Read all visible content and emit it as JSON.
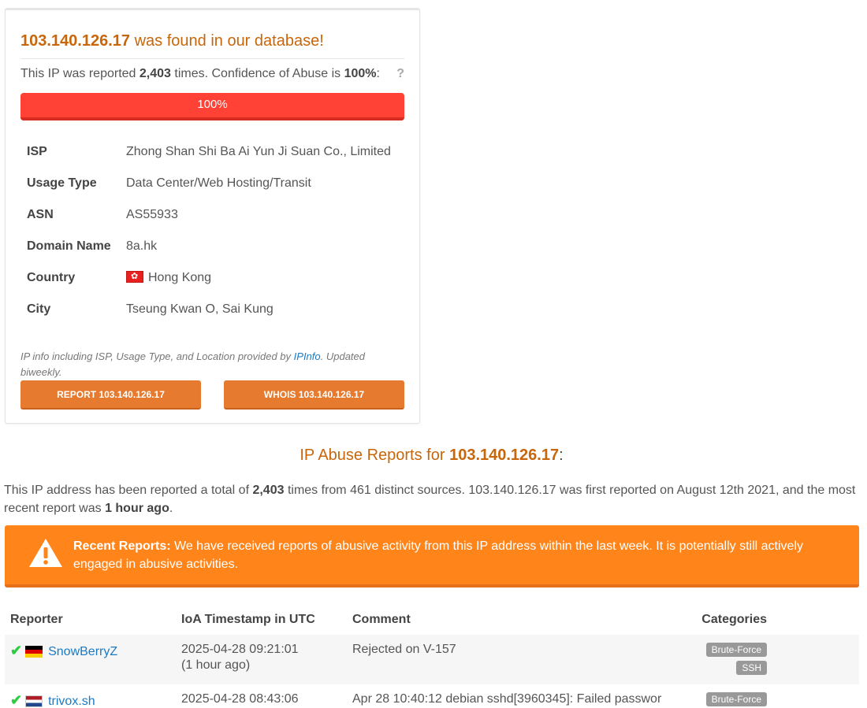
{
  "panel": {
    "ip": "103.140.126.17",
    "title_suffix": " was found in our database!",
    "report_prefix": "This IP was reported ",
    "report_count": "2,403",
    "report_middle": " times. Confidence of Abuse is ",
    "confidence": "100%",
    "report_suffix": ":",
    "help": "?",
    "progress_label": "100%",
    "progress_value": 1.0,
    "info": [
      {
        "key": "ISP",
        "value": "Zhong Shan Shi Ba Ai Yun Ji Suan Co., Limited"
      },
      {
        "key": "Usage Type",
        "value": "Data Center/Web Hosting/Transit"
      },
      {
        "key": "ASN",
        "value": "AS55933"
      },
      {
        "key": "Domain Name",
        "value": "8a.hk"
      },
      {
        "key": "Country",
        "value": "Hong Kong"
      },
      {
        "key": "City",
        "value": "Tseung Kwan O, Sai Kung"
      }
    ],
    "provided_prefix": "IP info including ISP, Usage Type, and Location provided by ",
    "provided_link": "IPInfo",
    "provided_suffix": ". Updated biweekly.",
    "report_button": "REPORT 103.140.126.17",
    "whois_button": "WHOIS 103.140.126.17"
  },
  "section": {
    "title_prefix": "IP Abuse Reports for ",
    "ip": "103.140.126.17",
    "colon": ":"
  },
  "summary": {
    "prefix": "This IP address has been reported a total of ",
    "count": "2,403",
    "middle": " times from 461 distinct sources. 103.140.126.17 was first reported on August 12th 2021, and the most recent report was ",
    "recent": "1 hour ago",
    "suffix": "."
  },
  "alert": {
    "icon": "warning-icon",
    "heading": "Recent Reports:",
    "text": " We have received reports of abusive activity from this IP address within the last week. It is potentially still actively engaged in abusive activities."
  },
  "reports_table": {
    "headers": {
      "reporter": "Reporter",
      "timestamp": "IoA Timestamp in UTC",
      "comment": "Comment",
      "categories": "Categories"
    },
    "rows": [
      {
        "reporter": "SnowBerryZ",
        "flag": "Germany",
        "timestamp": "2025-04-28 09:21:01",
        "relative": "(1 hour ago)",
        "comment": "Rejected on V-157",
        "categories": [
          "Brute-Force",
          "SSH"
        ]
      },
      {
        "reporter": "trivox.sh",
        "flag": "Netherlands",
        "timestamp": "2025-04-28 08:43:06",
        "comment": "Apr 28 10:40:12 debian sshd[3960345]: Failed passwor",
        "categories": [
          "Brute-Force"
        ]
      }
    ]
  },
  "colors": {
    "accent": "#c8660b",
    "danger": "#ff4136",
    "warning": "#ff851b",
    "button": "#e67a2e",
    "success": "#2ecc40",
    "link": "#1b7ac4"
  }
}
